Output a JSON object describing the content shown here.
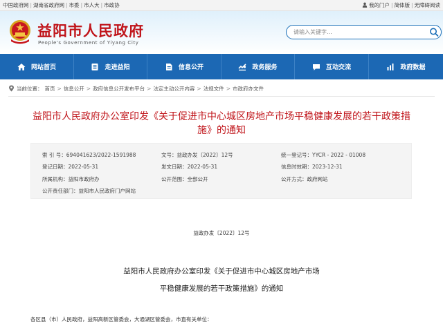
{
  "topbar": {
    "links": [
      "中国政府网",
      "湖南省政府网",
      "市委",
      "市人大",
      "市政协"
    ],
    "user_links": [
      "我的门户",
      "简体版",
      "无障碍阅读"
    ]
  },
  "header": {
    "title": "益阳市人民政府",
    "subtitle": "People's Government of Yiyang City",
    "search_placeholder": "请输入关键字..."
  },
  "nav": {
    "items": [
      {
        "label": "网站首页",
        "icon": "home-icon"
      },
      {
        "label": "走进益阳",
        "icon": "book-icon"
      },
      {
        "label": "信息公开",
        "icon": "document-icon"
      },
      {
        "label": "政务服务",
        "icon": "service-icon"
      },
      {
        "label": "互动交流",
        "icon": "chat-icon"
      },
      {
        "label": "政府数据",
        "icon": "data-icon"
      }
    ]
  },
  "breadcrumb": {
    "prefix": "当前位置：",
    "items": [
      "首页",
      "信息公开",
      "政府信息公开发布平台",
      "法定主动公开内容",
      "法规文件",
      "市政府办文件"
    ]
  },
  "article": {
    "title": "益阳市人民政府办公室印发《关于促进市中心城区房地产市场平稳健康发展的若干政策措施》的通知"
  },
  "meta": {
    "index_no": "索 引 号：694041623/2022-1591988",
    "doc_no": "文号：益政办发〔2022〕12号",
    "unified_no": "统一登记号：YYCR - 2022 - 01008",
    "reg_date": "登记日期：2022-05-31",
    "pub_date": "发文日期：2022-05-31",
    "valid_date": "信息时效期：2023-12-31",
    "org": "所属机构：益阳市政府办",
    "scope": "公开范围：全部公开",
    "method": "公开方式：政府网站",
    "dept": "公开责任部门：益阳市人民政府门户网站"
  },
  "body": {
    "doc_number": "益政办发〔2022〕12号",
    "title_line1": "益阳市人民政府办公室印发《关于促进市中心城区房地产市场",
    "title_line2": "平稳健康发展的若干政策措施》的通知",
    "greeting": "各区县（市）人民政府，益阳高新区管委会，大通湖区管委会，市直有关单位："
  },
  "colors": {
    "brand_red": "#c0141a",
    "nav_blue": "#1c68b4"
  }
}
